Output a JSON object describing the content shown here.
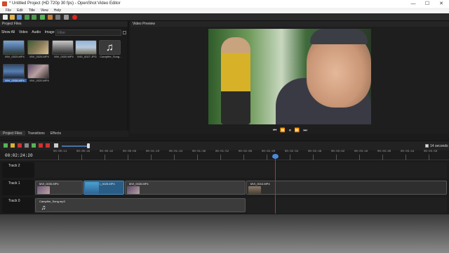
{
  "window": {
    "title": "* Untitled Project (HD 720p 30 fps) - OpenShot Video Editor",
    "minimize": "—",
    "maximize": "☐",
    "close": "✕"
  },
  "menu": [
    "File",
    "Edit",
    "Title",
    "View",
    "Help"
  ],
  "project_files": {
    "title": "Project Files",
    "filters": [
      "Show All",
      "Video",
      "Audio",
      "Image"
    ],
    "filter_placeholder": "Filter",
    "items": [
      {
        "label": "MVI_0025.MP4"
      },
      {
        "label": "MVI_0026.MP4"
      },
      {
        "label": "MVI_0030.MP4"
      },
      {
        "label": "IMG_0027.JPG"
      },
      {
        "label": "Campfire_Song..."
      },
      {
        "label": "MVI_0038.MP4"
      },
      {
        "label": "MVI_0020.MP4"
      }
    ]
  },
  "video_preview": {
    "title": "Video Preview",
    "transport": [
      "⏮",
      "⏪",
      "⏸",
      "⏩",
      "⏭"
    ]
  },
  "tabs": [
    "Project Files",
    "Transitions",
    "Effects"
  ],
  "timeline": {
    "current_time": "00:02:24:20",
    "zoom_label": "14 seconds",
    "ticks": [
      "00:00:14",
      "00:00:28",
      "00:00:42",
      "00:00:56",
      "00:01:10",
      "00:01:24",
      "00:01:38",
      "00:01:52",
      "00:02:06",
      "00:02:20",
      "00:02:34",
      "00:02:48",
      "00:03:02",
      "00:03:16",
      "00:03:30",
      "00:03:44",
      "00:03:58"
    ],
    "tracks": [
      {
        "name": "Track 2",
        "clips": []
      },
      {
        "name": "Track 1",
        "clips": [
          "MVI_0030.MP4",
          "I_0025.MP4",
          "MVI_0026.MP4",
          "MVI_0010.MP4"
        ]
      },
      {
        "name": "Track 0",
        "clips": [
          "Campfire_Song.mp3"
        ]
      }
    ]
  },
  "colors": {
    "accent": "#4b89d8",
    "playhead": "#dd2222",
    "selection": "#2a62b8"
  },
  "icons": [
    "app-icon",
    "new-icon",
    "open-icon",
    "save-icon",
    "undo-icon",
    "redo-icon",
    "import-icon",
    "profile-icon",
    "fullscreen-icon",
    "export-icon",
    "add-track-icon",
    "snap-icon",
    "razor-icon",
    "marker-icon",
    "prev-marker-icon",
    "next-marker-icon",
    "center-icon"
  ]
}
